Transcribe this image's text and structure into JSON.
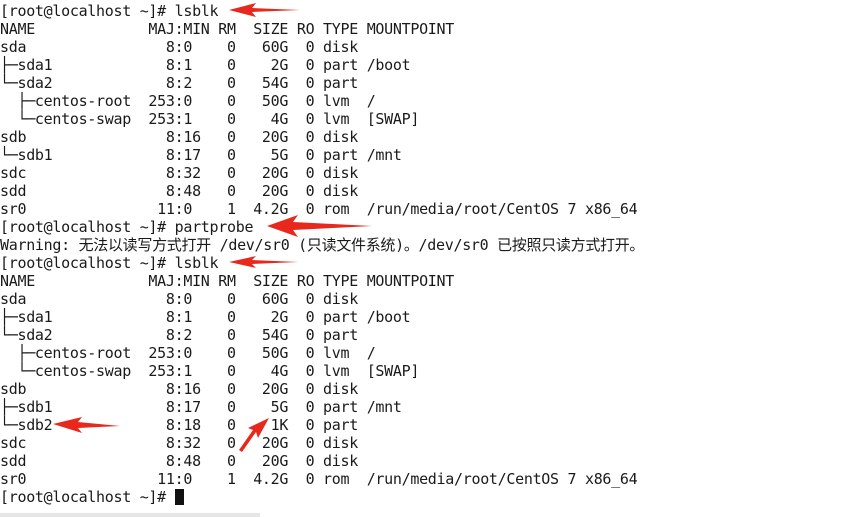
{
  "terminal": {
    "lines": [
      "[root@localhost ~]# lsblk",
      "NAME             MAJ:MIN RM  SIZE RO TYPE MOUNTPOINT",
      "sda                8:0    0   60G  0 disk",
      "├─sda1             8:1    0    2G  0 part /boot",
      "└─sda2             8:2    0   54G  0 part",
      "  ├─centos-root  253:0    0   50G  0 lvm  /",
      "  └─centos-swap  253:1    0    4G  0 lvm  [SWAP]",
      "sdb                8:16   0   20G  0 disk",
      "└─sdb1             8:17   0    5G  0 part /mnt",
      "sdc                8:32   0   20G  0 disk",
      "sdd                8:48   0   20G  0 disk",
      "sr0               11:0    1  4.2G  0 rom  /run/media/root/CentOS 7 x86_64",
      "[root@localhost ~]# partprobe",
      "Warning: 无法以读写方式打开 /dev/sr0 (只读文件系统)。/dev/sr0 已按照只读方式打开。",
      "[root@localhost ~]# lsblk",
      "NAME             MAJ:MIN RM  SIZE RO TYPE MOUNTPOINT",
      "sda                8:0    0   60G  0 disk",
      "├─sda1             8:1    0    2G  0 part /boot",
      "└─sda2             8:2    0   54G  0 part",
      "  ├─centos-root  253:0    0   50G  0 lvm  /",
      "  └─centos-swap  253:1    0    4G  0 lvm  [SWAP]",
      "sdb                8:16   0   20G  0 disk",
      "├─sdb1             8:17   0    5G  0 part /mnt",
      "└─sdb2             8:18   0    1K  0 part",
      "sdc                8:32   0   20G  0 disk",
      "sdd                8:48   0   20G  0 disk",
      "sr0               11:0    1  4.2G  0 rom  /run/media/root/CentOS 7 x86_64",
      "[root@localhost ~]# "
    ]
  },
  "colors": {
    "annotation_arrow": "#e8281d",
    "text": "#1a1a1a",
    "background": "#ffffff"
  }
}
